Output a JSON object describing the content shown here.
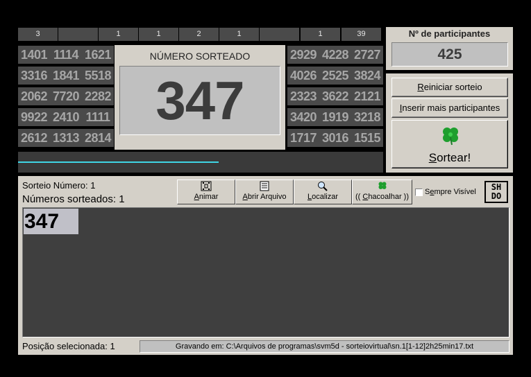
{
  "top_counts": [
    "3",
    "",
    "1",
    "1",
    "2",
    "1",
    "",
    "1",
    "39"
  ],
  "left_numbers": [
    [
      "1401",
      "1114",
      "1621"
    ],
    [
      "3316",
      "1841",
      "5518"
    ],
    [
      "2062",
      "7720",
      "2282"
    ],
    [
      "9922",
      "2410",
      "1111"
    ],
    [
      "2612",
      "1313",
      "2814"
    ]
  ],
  "right_numbers": [
    [
      "2929",
      "4228",
      "2727"
    ],
    [
      "4026",
      "2525",
      "3824"
    ],
    [
      "2323",
      "3622",
      "2121"
    ],
    [
      "3420",
      "1919",
      "3218"
    ],
    [
      "1717",
      "3016",
      "1515"
    ]
  ],
  "center": {
    "title": "NÚMERO SORTEADO",
    "number": "347"
  },
  "participants": {
    "label": "Nº de participantes",
    "value": "425"
  },
  "buttons": {
    "restart": {
      "prefix": "",
      "accel": "R",
      "rest": "einiciar sorteio"
    },
    "insert": {
      "prefix": "",
      "accel": "I",
      "rest": "nserir mais participantes"
    },
    "draw": {
      "prefix": "",
      "accel": "S",
      "rest": "ortear!",
      "icon": "clover-icon"
    }
  },
  "progress": 0.55,
  "status": {
    "draw_number": "Sorteio Número: 1",
    "drawn_count": "Números sorteados: 1"
  },
  "toolbar": {
    "animate": {
      "prefix": "",
      "accel": "A",
      "rest": "nimar",
      "icon": "film-icon"
    },
    "open_file": {
      "prefix": "",
      "accel": "A",
      "rest": "brir Arquivo",
      "icon": "document-icon"
    },
    "locate": {
      "prefix": "",
      "accel": "L",
      "rest": "ocalizar",
      "icon": "search-icon"
    },
    "shake": {
      "prefix": "(( ",
      "accel": "C",
      "rest": "hacoalhar ))",
      "icon": "clover-icon"
    }
  },
  "always_visible": {
    "prefix": "S",
    "accel": "e",
    "rest": "mpre Visível",
    "checked": false
  },
  "logo": {
    "line1": "SH",
    "line2": "DO"
  },
  "drawn_list": [
    "347"
  ],
  "footer": {
    "selected_position": "Posição selecionada: 1",
    "saving_path": "Gravando em: C:\\Arquivos de programas\\svm5d - sorteiovirtual\\sn.1[1-12]2h25min17.txt"
  }
}
